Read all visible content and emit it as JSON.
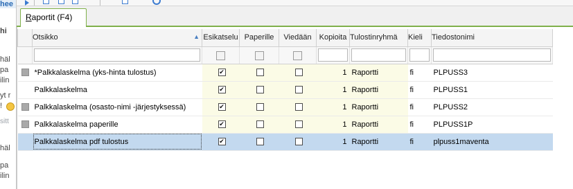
{
  "background_window": {
    "fragments": [
      "hee",
      "hi",
      "häl",
      "pa",
      "ilin",
      "yt r",
      "!",
      "sitt",
      "häl",
      "pa",
      "ilin"
    ]
  },
  "tab": {
    "label_accel": "R",
    "label_rest": "aportit (F4)"
  },
  "grid": {
    "columns": [
      "Otsikko",
      "Esikatselu",
      "Paperille",
      "Viedään",
      "Kopioita",
      "Tulostinryhmä",
      "Kieli",
      "Tiedostonimi"
    ],
    "sort_indicator": "▲",
    "rows": [
      {
        "marker": true,
        "title": "*Palkkalaskelma (yks-hinta tulostus)",
        "esikatselu": true,
        "paperille": false,
        "viedaan": false,
        "kopioita": "1",
        "ryhma": "Raportti",
        "kieli": "fi",
        "tiedosto": "PLPUSS3"
      },
      {
        "marker": false,
        "title": "Palkkalaskelma",
        "esikatselu": true,
        "paperille": false,
        "viedaan": false,
        "kopioita": "1",
        "ryhma": "Raportti",
        "kieli": "fi",
        "tiedosto": "PLPUSS1"
      },
      {
        "marker": true,
        "title": "Palkkalaskelma (osasto-nimi -järjestyksessä)",
        "esikatselu": true,
        "paperille": false,
        "viedaan": false,
        "kopioita": "1",
        "ryhma": "Raportti",
        "kieli": "fi",
        "tiedosto": "PLPUSS2"
      },
      {
        "marker": true,
        "title": "Palkkalaskelma paperille",
        "esikatselu": true,
        "paperille": false,
        "viedaan": false,
        "kopioita": "1",
        "ryhma": "Raportti",
        "kieli": "fi",
        "tiedosto": "PLPUSS1P"
      },
      {
        "marker": false,
        "title": "Palkkalaskelma pdf tulostus",
        "esikatselu": true,
        "paperille": false,
        "viedaan": false,
        "kopioita": "1",
        "ryhma": "Raportti",
        "kieli": "fi",
        "tiedosto": "plpuss1maventa",
        "selected": true
      }
    ]
  },
  "colors": {
    "tab_border": "#7fb04a",
    "selected_row": "#c3d9ef",
    "yellow_col": "#fbfbe6",
    "toolbar_icon": "#3b7bd0"
  }
}
